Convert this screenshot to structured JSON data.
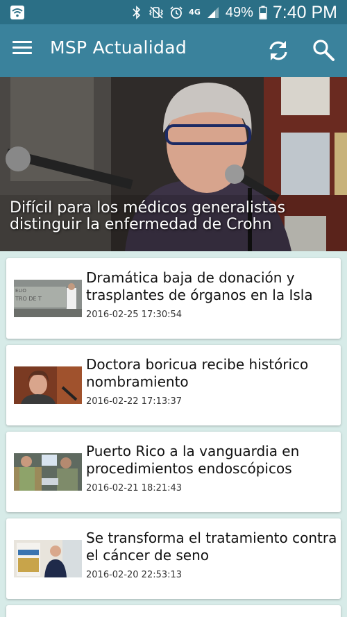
{
  "status_bar": {
    "battery_percent": "49%",
    "network": "4G",
    "time": "7:40 PM",
    "icons": [
      "wifi-icon",
      "bluetooth-icon",
      "vibrate-icon",
      "alarm-icon",
      "signal-icon",
      "battery-icon"
    ]
  },
  "app_bar": {
    "title": "MSP Actualidad",
    "icons": [
      "menu-icon",
      "refresh-icon",
      "search-icon"
    ]
  },
  "hero": {
    "title": "Difícil para los médicos generalistas distinguir la enfermedad de Crohn"
  },
  "articles": [
    {
      "title": "Dramática baja de donación y trasplantes de órganos en la Isla",
      "date": "2016-02-25 17:30:54"
    },
    {
      "title": "Doctora boricua recibe histórico nombramiento",
      "date": "2016-02-22 17:13:37"
    },
    {
      "title": "Puerto Rico a la vanguardia en procedimientos endoscópicos",
      "date": "2016-02-21 18:21:43"
    },
    {
      "title": "Se transforma el tratamiento contra el cáncer de seno",
      "date": "2016-02-20 22:53:13"
    }
  ],
  "colors": {
    "status_bar": "#2b6f86",
    "app_bar": "#3a829c",
    "background": "#d7ebe8"
  }
}
